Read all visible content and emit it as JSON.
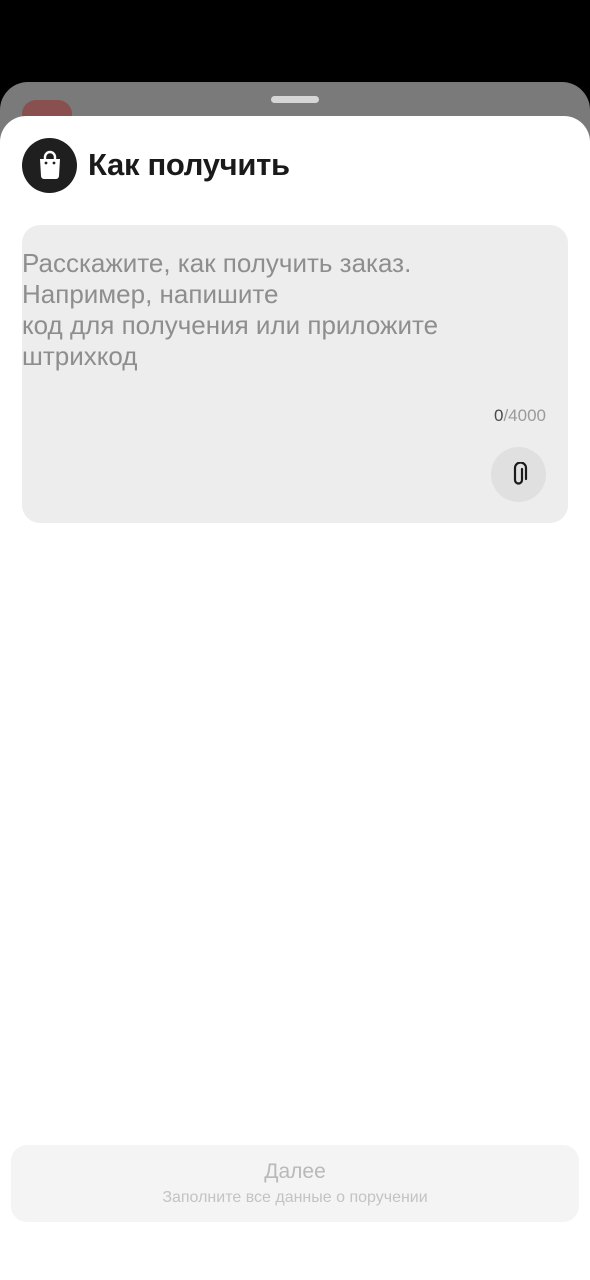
{
  "sheet": {
    "title": "Как получить",
    "icon": "shopping-bag-icon"
  },
  "input": {
    "placeholder_lines": [
      "Расскажите, как получить заказ.",
      "Например, напишите",
      "код для получения или приложите",
      "штрихкод"
    ],
    "value": "",
    "counter_current": "0",
    "counter_max": "/4000",
    "attach_icon": "paperclip-icon"
  },
  "footer": {
    "next_label": "Далее",
    "next_hint": "Заполните все данные о поручении",
    "enabled": false
  },
  "colors": {
    "sheet_bg": "#ffffff",
    "input_bg": "#ededed",
    "icon_circle": "#1f1f1f",
    "disabled_text": "#b9b9b9"
  }
}
